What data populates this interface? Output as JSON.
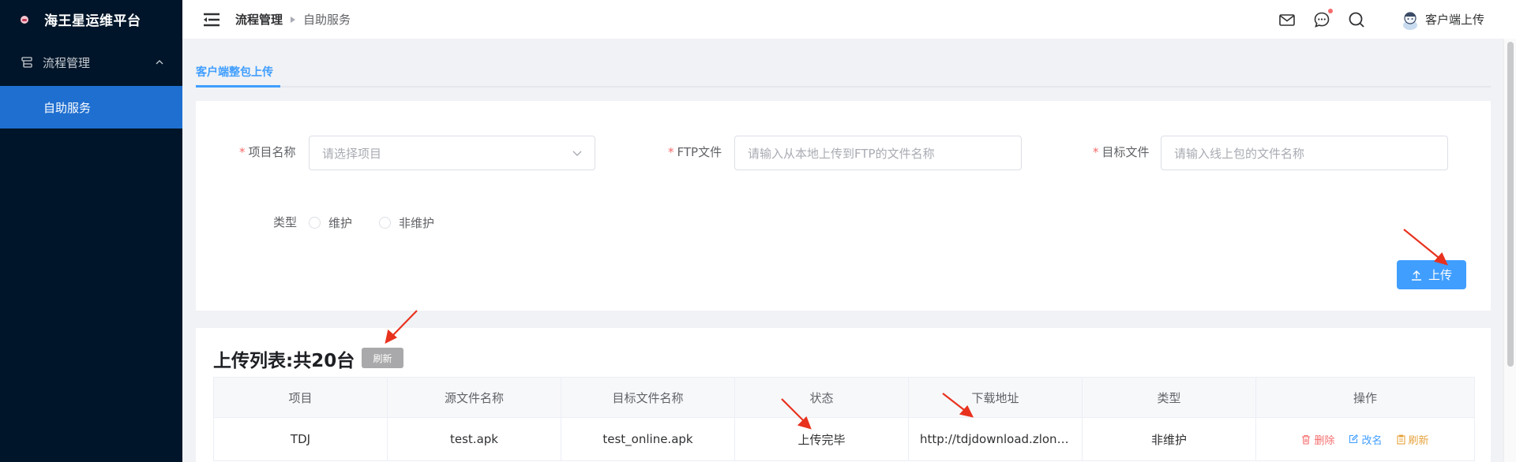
{
  "sidebar": {
    "brand_title": "海王星运维平台",
    "menu_group_label": "流程管理",
    "active_item_label": "自助服务"
  },
  "header": {
    "breadcrumb": [
      "流程管理",
      "自助服务"
    ],
    "username": "客户端上传"
  },
  "tabs": {
    "active_label": "客户端整包上传"
  },
  "form": {
    "project_label": "项目名称",
    "project_placeholder": "请选择项目",
    "ftp_label": "FTP文件",
    "ftp_placeholder": "请输入从本地上传到FTP的文件名称",
    "target_label": "目标文件",
    "target_placeholder": "请输入线上包的文件名称",
    "required_mark": "*",
    "type_label": "类型",
    "type_options": [
      "维护",
      "非维护"
    ],
    "upload_label": "上传"
  },
  "list": {
    "title": "上传列表:共20台",
    "refresh_label": "刷新",
    "columns": [
      "项目",
      "源文件名称",
      "目标文件名称",
      "状态",
      "下载地址",
      "类型",
      "操作"
    ],
    "rows": [
      {
        "project": "TDJ",
        "source": "test.apk",
        "target": "test_online.apk",
        "status": "上传完毕",
        "url": "http://tdjdownload.zlongame.com/test_online.apk",
        "type": "非维护",
        "actions": [
          "删除",
          "改名",
          "刷新"
        ]
      }
    ]
  },
  "colors": {
    "sidebar_bg": "#001529",
    "active_menu": "#1f6fd0",
    "primary": "#409eff",
    "danger": "#f56c6c",
    "warning": "#e6a23c",
    "annotation_arrow": "#e8321e"
  }
}
